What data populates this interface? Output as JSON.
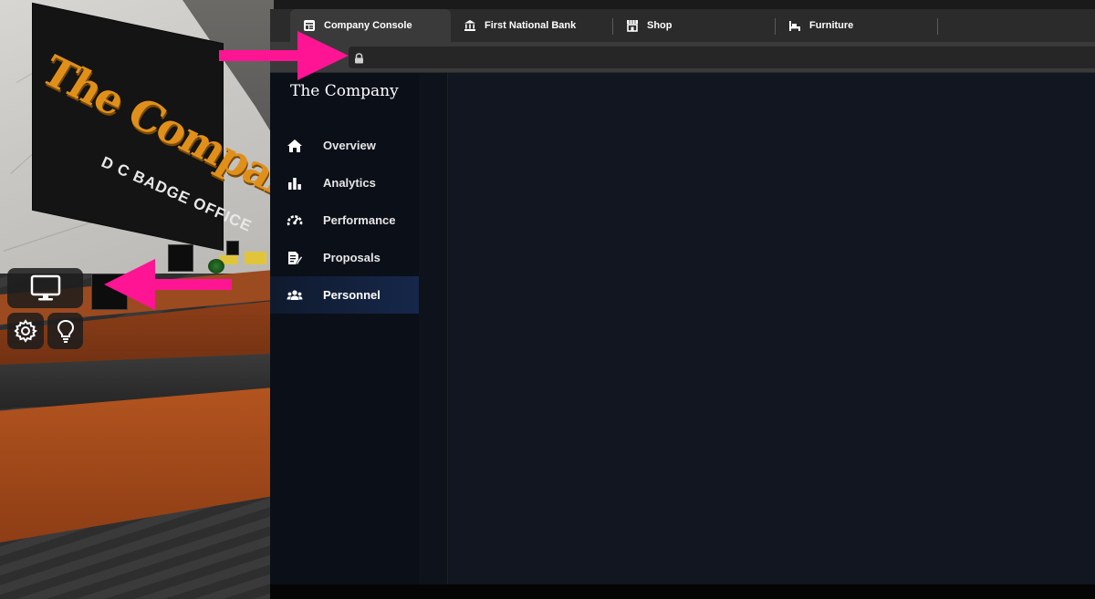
{
  "scene": {
    "sign_title": "The Company",
    "sign_subtitle": "D C BADGE OFFICE"
  },
  "browser": {
    "tabs": [
      {
        "label": "Company Console",
        "icon": "console-icon",
        "active": true
      },
      {
        "label": "First National Bank",
        "icon": "bank-icon",
        "active": false
      },
      {
        "label": "Shop",
        "icon": "shop-icon",
        "active": false
      },
      {
        "label": "Furniture",
        "icon": "furniture-icon",
        "active": false
      }
    ],
    "address": {
      "icon": "lock-icon"
    }
  },
  "app": {
    "brand": "The Company",
    "nav": [
      {
        "label": "Overview",
        "icon": "home-icon",
        "active": false
      },
      {
        "label": "Analytics",
        "icon": "bar-chart-icon",
        "active": false
      },
      {
        "label": "Performance",
        "icon": "speedometer-icon",
        "active": false
      },
      {
        "label": "Proposals",
        "icon": "document-edit-icon",
        "active": false
      },
      {
        "label": "Personnel",
        "icon": "users-icon",
        "active": true
      }
    ]
  },
  "colors": {
    "annotation_arrow": "#ff1493",
    "active_nav": "#16274a",
    "sign_text": "#e0901a"
  }
}
